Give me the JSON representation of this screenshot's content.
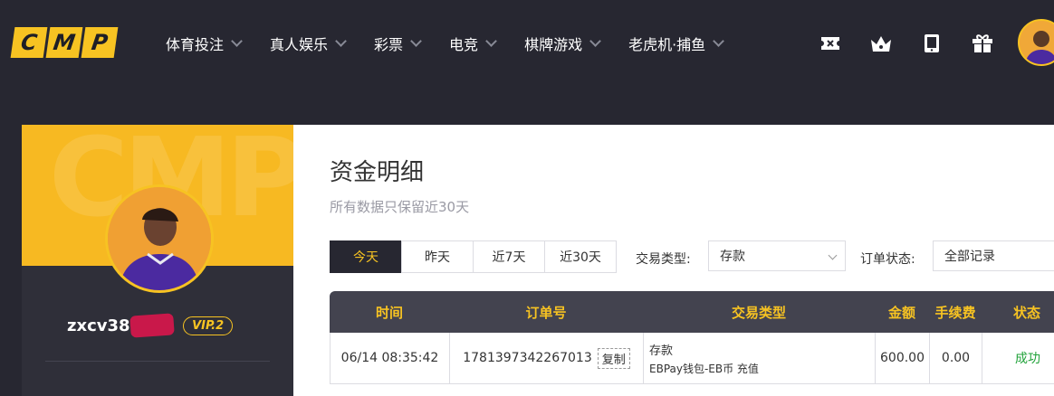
{
  "logo": {
    "letters": [
      "C",
      "M",
      "P"
    ],
    "color": "#f7c322"
  },
  "nav": [
    {
      "label": "体育投注"
    },
    {
      "label": "真人娱乐"
    },
    {
      "label": "彩票"
    },
    {
      "label": "电竞"
    },
    {
      "label": "棋牌游戏"
    },
    {
      "label": "老虎机·捕鱼"
    }
  ],
  "top_icons": [
    "ticket-icon",
    "crown-icon",
    "tablet-icon",
    "gift-icon"
  ],
  "profile": {
    "username": "zxcv388",
    "vip": "VIP.2",
    "banner_watermark": "CMP"
  },
  "page": {
    "title": "资金明细",
    "subtitle": "所有数据只保留近30天"
  },
  "tabs": [
    {
      "label": "今天",
      "active": true
    },
    {
      "label": "昨天",
      "active": false
    },
    {
      "label": "近7天",
      "active": false
    },
    {
      "label": "近30天",
      "active": false
    }
  ],
  "filters": {
    "type_label": "交易类型:",
    "type_value": "存款",
    "status_label": "订单状态:",
    "status_value": "全部记录"
  },
  "table": {
    "headers": {
      "time": "时间",
      "order": "订单号",
      "type": "交易类型",
      "amount": "金额",
      "fee": "手续费",
      "status": "状态"
    },
    "rows": [
      {
        "time": "06/14 08:35:42",
        "order": "1781397342267013",
        "copy": "复制",
        "type_main": "存款",
        "type_sub": "EBPay钱包-EB币 充值",
        "amount": "600.00",
        "fee": "0.00",
        "status": "成功"
      }
    ]
  },
  "colors": {
    "accent": "#f7c322",
    "dark_bg": "#272731",
    "success": "#21a23a"
  }
}
